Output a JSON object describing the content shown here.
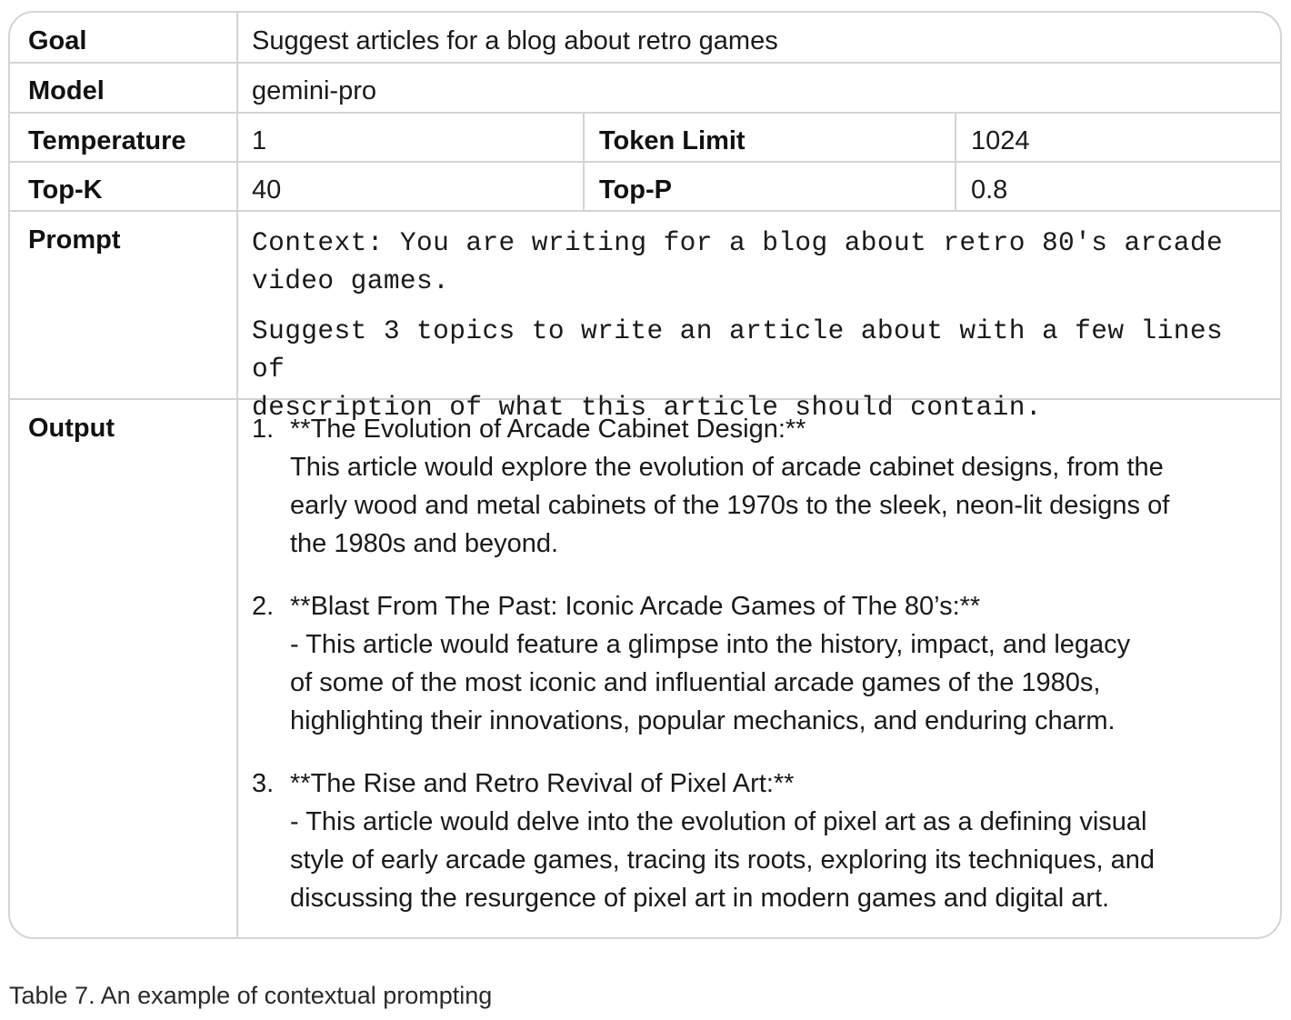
{
  "rows": {
    "goal": {
      "label": "Goal",
      "value": "Suggest articles for a blog about retro games"
    },
    "model": {
      "label": "Model",
      "value": "gemini-pro"
    },
    "temperature": {
      "label": "Temperature",
      "value": "1"
    },
    "token_limit": {
      "label": "Token Limit",
      "value": "1024"
    },
    "top_k": {
      "label": "Top-K",
      "value": "40"
    },
    "top_p": {
      "label": "Top-P",
      "value": "0.8"
    },
    "prompt": {
      "label": "Prompt",
      "paragraphs": [
        "Context: You are writing for a blog about retro 80's arcade\nvideo games.",
        "Suggest 3 topics to write an article about with a few lines of\ndescription of what this article should contain."
      ]
    },
    "output": {
      "label": "Output",
      "items": [
        {
          "number": "1.",
          "title": "**The Evolution of Arcade Cabinet Design:**",
          "lines": [
            "This article would explore the evolution of arcade cabinet designs, from the",
            "early wood and metal cabinets of the 1970s to the sleek, neon-lit designs of",
            "the 1980s and beyond."
          ]
        },
        {
          "number": "2.",
          "title": "**Blast From The Past: Iconic Arcade Games of The 80’s:**",
          "lines": [
            "- This article would feature a glimpse into the history, impact, and legacy",
            "of some of the most iconic and influential arcade games of the 1980s,",
            "highlighting their innovations, popular mechanics, and enduring charm."
          ]
        },
        {
          "number": "3.",
          "title": "**The Rise and Retro Revival of Pixel Art:**",
          "lines": [
            "- This article would delve into the evolution of pixel art as a defining visual",
            "style of early arcade games, tracing its roots, exploring its techniques, and",
            "discussing the resurgence of pixel art in modern games and digital art."
          ]
        }
      ]
    }
  },
  "caption": "Table 7. An example of contextual prompting",
  "colors": {
    "border": "#d4d4d4",
    "text": "#1a1a1a"
  }
}
